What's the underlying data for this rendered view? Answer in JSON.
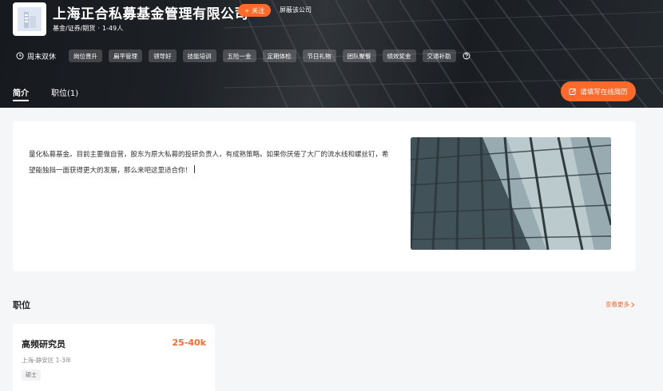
{
  "company": {
    "name": "上海正合私募基金管理有限公司",
    "follow_label": "+ 关注",
    "block_label": "屏蔽该公司",
    "industry": "基金/证券/期货",
    "separator": "·",
    "size": "1-49人"
  },
  "welfare": {
    "schedule": "周末双休",
    "tags": [
      "岗位晋升",
      "扁平管理",
      "领导好",
      "技能培训",
      "五险一金",
      "定期体检",
      "节日礼物",
      "团队聚餐",
      "绩效奖金",
      "交通补助"
    ]
  },
  "tabs": [
    {
      "label": "简介",
      "active": true
    },
    {
      "label": "职位(1)",
      "active": false
    }
  ],
  "resume_button": "请填写在线简历",
  "intro": {
    "text": "量化私募基金。目前主要做自营，股东为原大私募的投研负责人，有成熟策略。如果你厌倦了大厂的流水线和螺丝钉，希望能独挡一面获得更大的发展，那么来吧这里适合你！"
  },
  "jobs_section": {
    "title": "职位",
    "more_label": "查看更多",
    "jobs": [
      {
        "title": "高频研究员",
        "salary": "25-40k",
        "info": "上海-静安区 1-3年",
        "tag": "硕士"
      }
    ]
  },
  "colors": {
    "accent": "#ff6a2a",
    "banner_dark": "#1b1f24",
    "page_bg": "#f5f6f8"
  }
}
